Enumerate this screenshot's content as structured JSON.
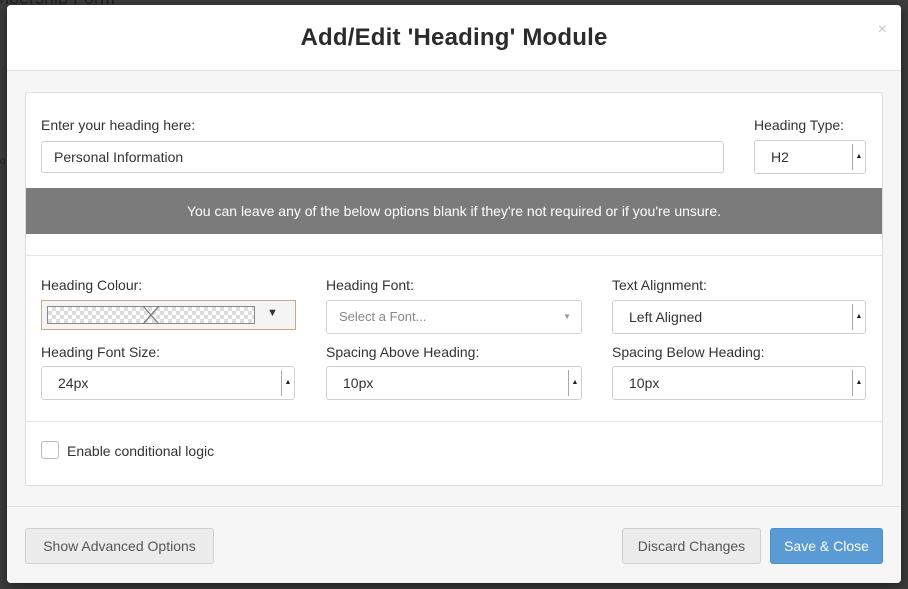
{
  "backdrop": {
    "title_fragment": "mbership Form",
    "edge_mark": "o"
  },
  "modal": {
    "title": "Add/Edit 'Heading' Module",
    "close_glyph": "×"
  },
  "heading": {
    "label": "Enter your heading here:",
    "value": "Personal Information"
  },
  "heading_type": {
    "label": "Heading Type:",
    "value": "H2"
  },
  "info_bar": {
    "text": "You can leave any of the below options blank if they're not required or if you're unsure."
  },
  "heading_colour": {
    "label": "Heading Colour:",
    "value": "transparent"
  },
  "heading_font": {
    "label": "Heading Font:",
    "placeholder": "Select a Font..."
  },
  "text_alignment": {
    "label": "Text Alignment:",
    "value": "Left Aligned"
  },
  "font_size": {
    "label": "Heading Font Size:",
    "value": "24px"
  },
  "spacing_above": {
    "label": "Spacing Above Heading:",
    "value": "10px"
  },
  "spacing_below": {
    "label": "Spacing Below Heading:",
    "value": "10px"
  },
  "conditional": {
    "label": "Enable conditional logic",
    "checked": false
  },
  "footer": {
    "advanced_label": "Show Advanced Options",
    "discard_label": "Discard Changes",
    "save_label": "Save & Close"
  },
  "colors": {
    "primary_button": "#5b9bd5",
    "info_bar": "#7b7b7b"
  }
}
